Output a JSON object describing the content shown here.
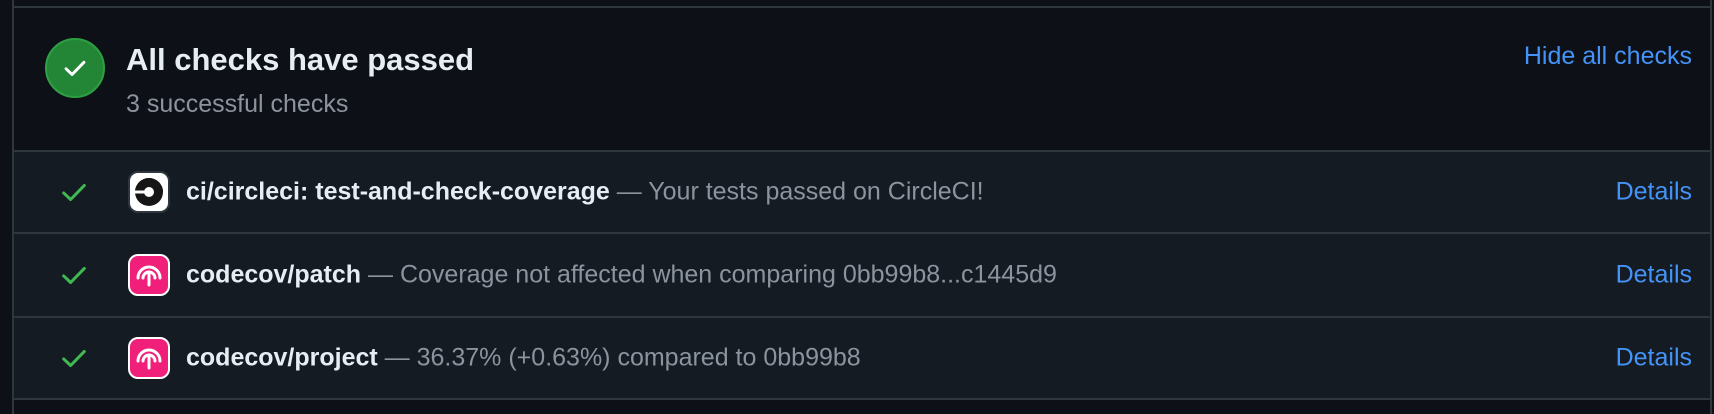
{
  "summary": {
    "title": "All checks have passed",
    "subtitle": "3 successful checks",
    "hide_link": "Hide all checks"
  },
  "checks": [
    {
      "name": "ci/circleci: test-and-check-coverage",
      "description": " — Your tests passed on CircleCI!",
      "details_label": "Details",
      "logo": "circleci-logo-icon"
    },
    {
      "name": "codecov/patch",
      "description": " — Coverage not affected when comparing 0bb99b8...c1445d9",
      "details_label": "Details",
      "logo": "codecov-logo-icon"
    },
    {
      "name": "codecov/project",
      "description": " — 36.37% (+0.63%) compared to 0bb99b8",
      "details_label": "Details",
      "logo": "codecov-logo-icon"
    }
  ],
  "colors": {
    "success": "#238636",
    "check_green": "#3fb950",
    "link": "#4493f8",
    "codecov_pink": "#f01f7a"
  }
}
